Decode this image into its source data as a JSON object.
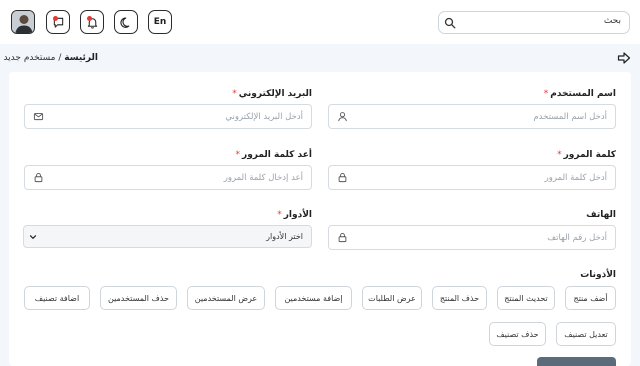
{
  "header": {
    "search_placeholder": "بحث",
    "search_icon": "search-icon",
    "lang_label": "En",
    "icons": [
      "moon-icon",
      "bell-icon",
      "chat-icon",
      "avatar"
    ]
  },
  "breadcrumb": {
    "home": "الرئيسة",
    "separator": " / ",
    "current": "مستخدم جديد"
  },
  "form": {
    "username": {
      "label": "اسم المستخدم",
      "required": "*",
      "placeholder": "أدخل اسم المستخدم"
    },
    "email": {
      "label": "البريد الإلكتروني",
      "required": "*",
      "placeholder": "أدخل البريد الإلكتروني"
    },
    "password": {
      "label": "كلمة المرور",
      "required": "*",
      "placeholder": "أدخل كلمة المرور"
    },
    "password_confirm": {
      "label": "أعد كلمة المرور",
      "required": "*",
      "placeholder": "أعد إدخال كلمة المرور"
    },
    "phone": {
      "label": "الهاتف",
      "placeholder": "أدخل رقم الهاتف"
    },
    "roles": {
      "label": "الأدوار",
      "required": "*",
      "selected": "اختر الأدوار"
    }
  },
  "permissions": {
    "label": "الأذونات",
    "items": [
      "أضف منتج",
      "تحديث المنتج",
      "حذف المنتج",
      "عرض الطلبات",
      "إضافة مستخدمين",
      "عرض المستخدمين",
      "حذف المستخدمين",
      "اضافة تصنيف",
      "تعديل تصنيف",
      "حذف تصنيف"
    ]
  },
  "colors": {
    "required": "#e53935",
    "submit": "#5c6b7a",
    "notification_dot": "#e53935"
  }
}
